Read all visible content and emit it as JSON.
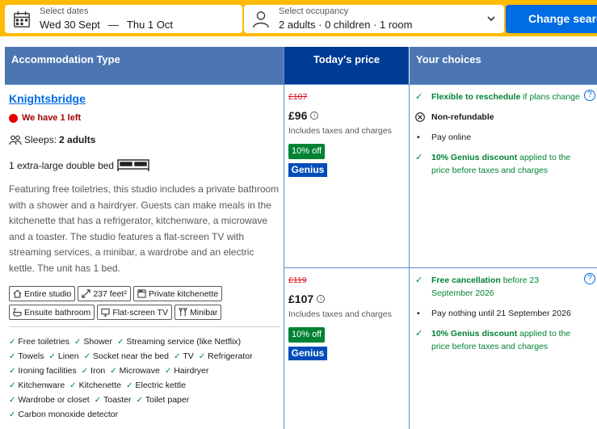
{
  "search": {
    "dates_label": "Select dates",
    "check_in": "Wed 30 Sept",
    "separator": "—",
    "check_out": "Thu 1 Oct",
    "occupancy_label": "Select occupancy",
    "occupancy_value": "2 adults · 0 children · 1 room",
    "submit_label": "Change search"
  },
  "table": {
    "col_type": "Accommodation Type",
    "col_price": "Today's price",
    "col_choices": "Your choices"
  },
  "room": {
    "name": "Knightsbridge",
    "availability": "We have 1 left",
    "sleeps_label": "Sleeps:",
    "sleeps_value": "2 adults",
    "bed": "1 extra-large double bed",
    "description": "Featuring free toiletries, this studio includes a private bathroom with a shower and a hairdryer. Guests can make meals in the kitchenette that has a refrigerator, kitchenware, a microwave and a toaster. The studio features a flat-screen TV with streaming services, a minibar, a wardrobe and an electric kettle. The unit has 1 bed.",
    "chips": [
      "Entire studio",
      "237 feet²",
      "Private kitchenette",
      "Ensuite bathroom",
      "Flat-screen TV",
      "Minibar"
    ],
    "amenities": [
      [
        "Free toiletries",
        "Shower",
        "Streaming service (like Netflix)"
      ],
      [
        "Towels",
        "Linen",
        "Socket near the bed",
        "TV",
        "Refrigerator"
      ],
      [
        "Ironing facilities",
        "Iron",
        "Microwave",
        "Hairdryer"
      ],
      [
        "Kitchenware",
        "Kitchenette",
        "Electric kettle"
      ],
      [
        "Wardrobe or closet",
        "Toaster",
        "Toilet paper"
      ],
      [
        "Carbon monoxide detector"
      ]
    ]
  },
  "offers": [
    {
      "old_price": "£107",
      "price": "£96",
      "taxes": "Includes taxes and charges",
      "discount_badge": "10% off",
      "genius_badge": "Genius",
      "choice1_strong": "Flexible to reschedule",
      "choice1_rest": " if plans change",
      "choice2": "Non-refundable",
      "choice3": "Pay online",
      "choice4_strong": "10% Genius discount",
      "choice4_rest": " applied to the price before taxes and charges"
    },
    {
      "old_price": "£119",
      "price": "£107",
      "taxes": "Includes taxes and charges",
      "discount_badge": "10% off",
      "genius_badge": "Genius",
      "choice1_strong": "Free cancellation",
      "choice1_rest": " before 23 September 2026",
      "choice2": "Pay nothing until 21 September 2026",
      "choice3_strong": "10% Genius discount",
      "choice3_rest": " applied to the price before taxes and charges"
    }
  ],
  "info_glyph": "i",
  "help_glyph": "?",
  "tick_glyph": "✓",
  "bullet_glyph": "•",
  "colors": {
    "brand_yellow": "#febb02",
    "header_blue": "#4c76b2",
    "price_header_blue": "#003b95",
    "link_blue": "#006ce4",
    "green": "#008234",
    "red": "#d4111e"
  }
}
